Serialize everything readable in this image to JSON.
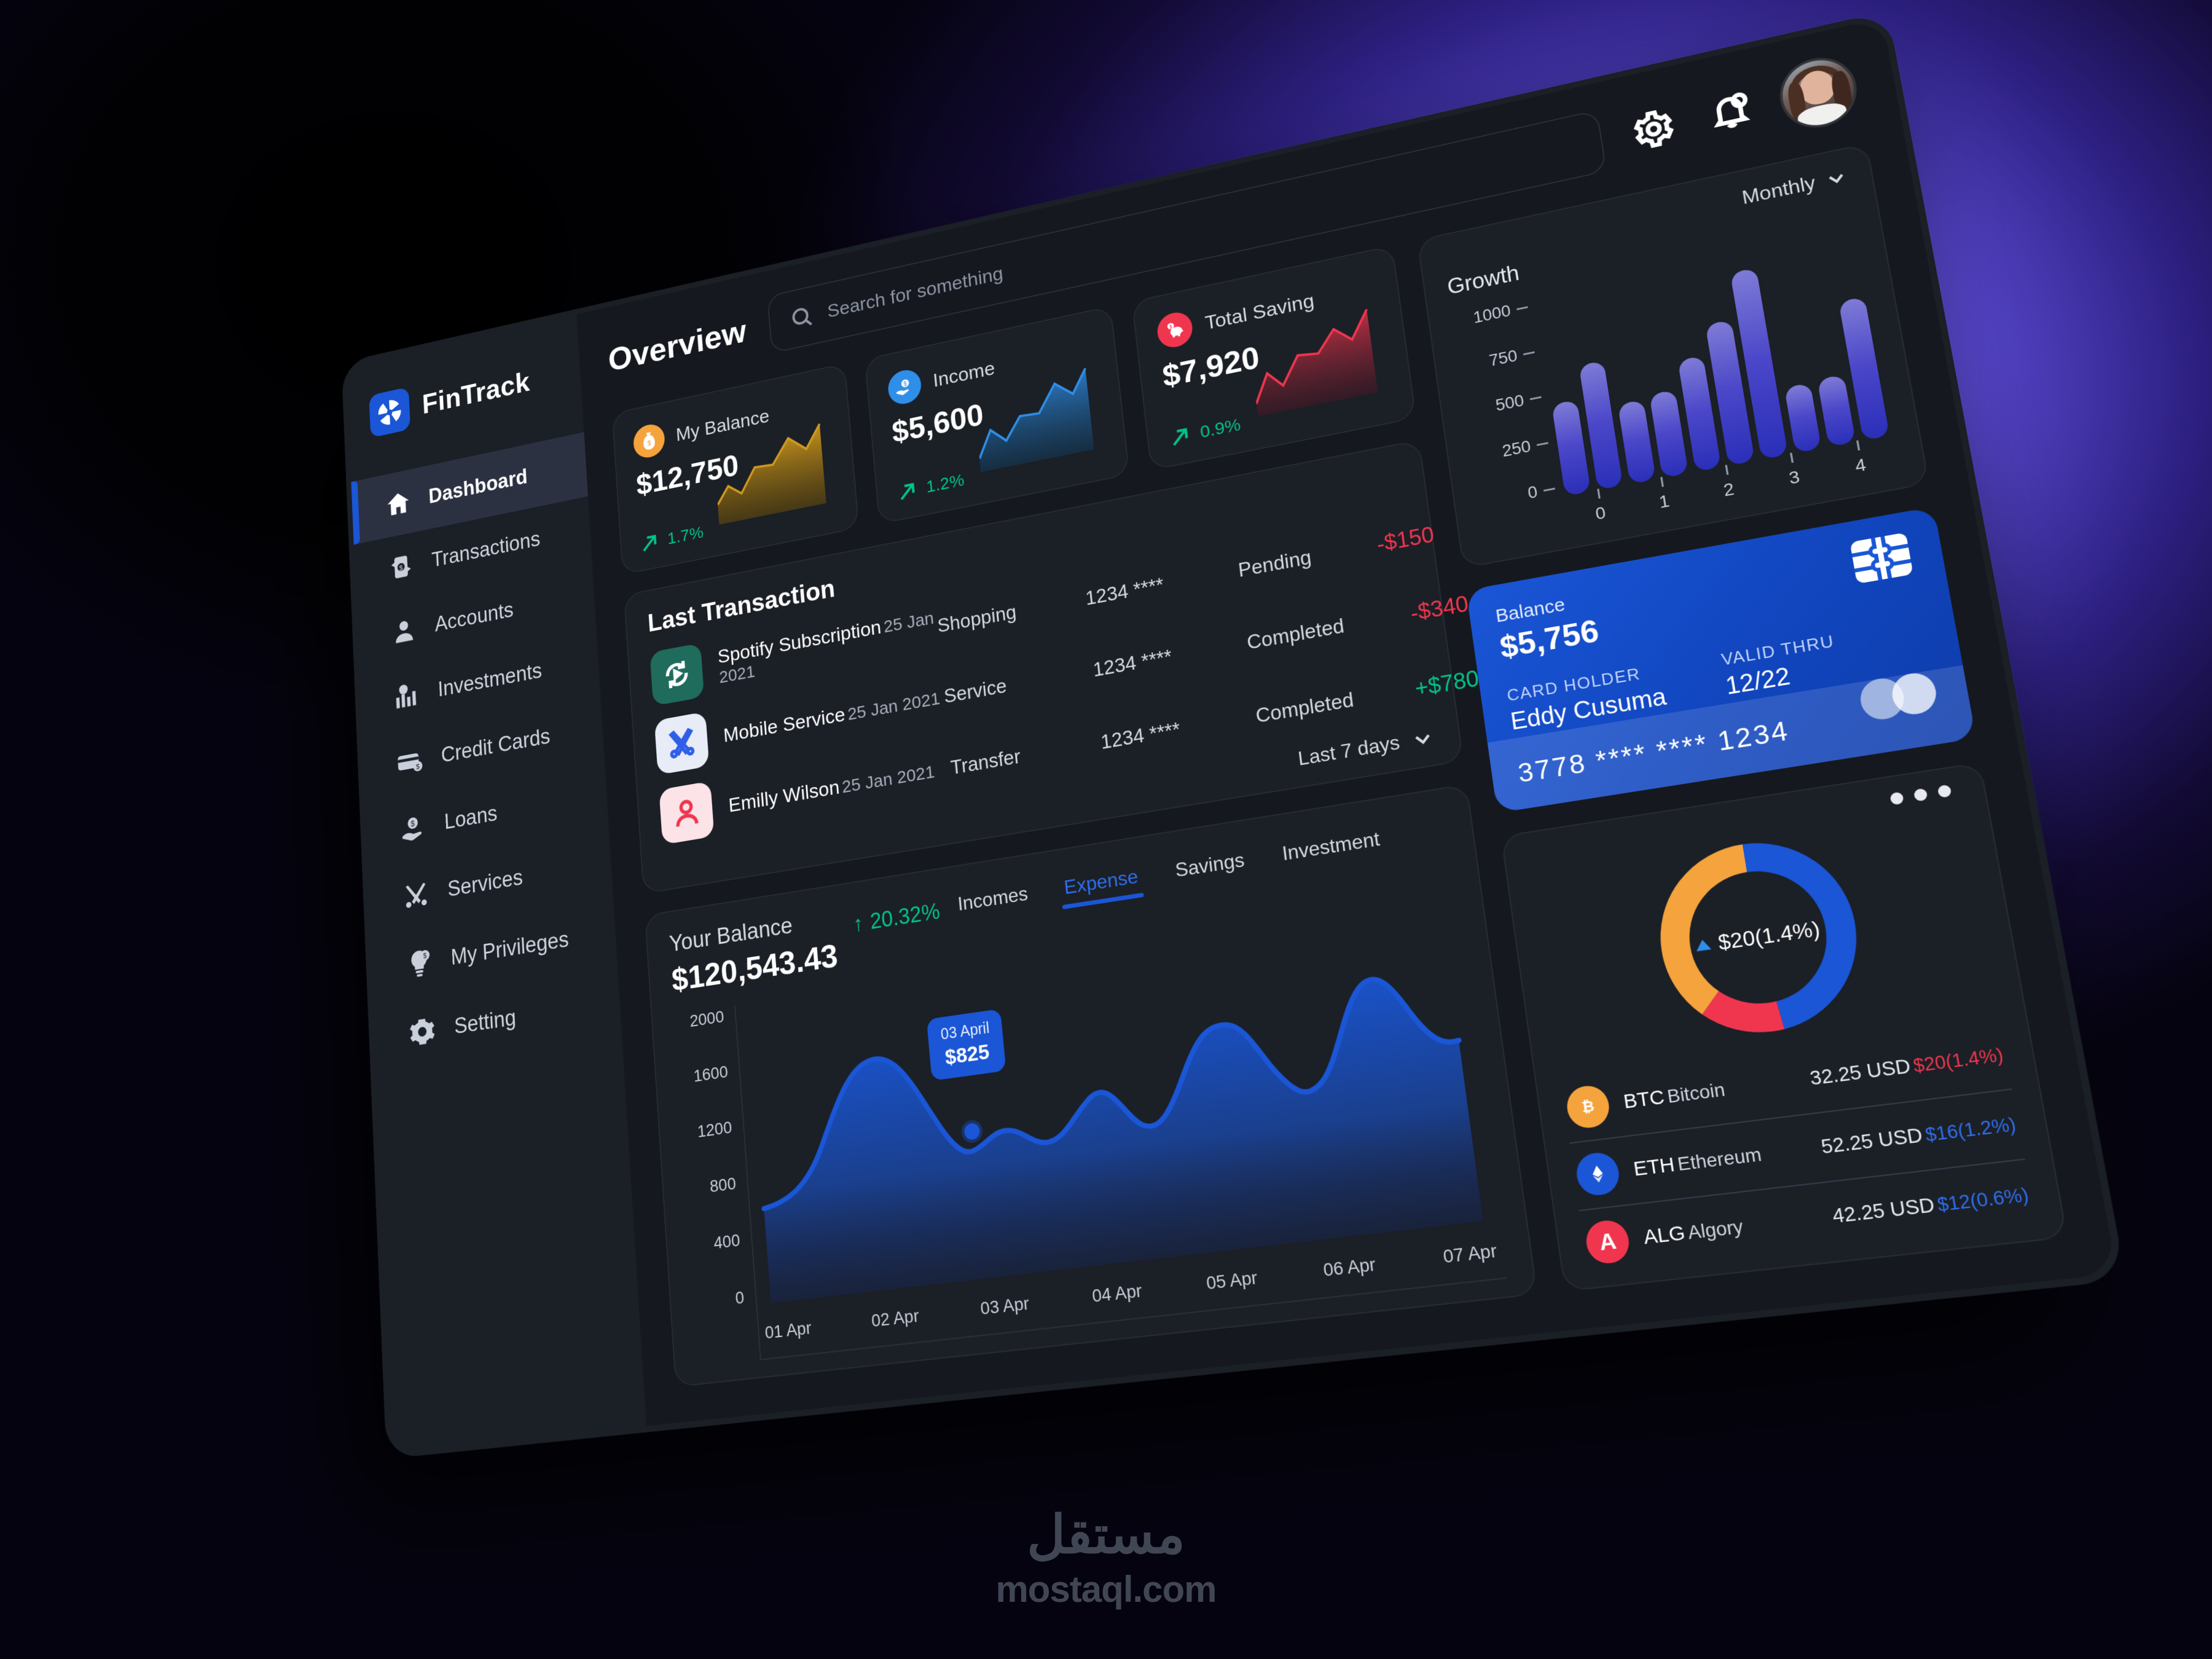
{
  "brand": {
    "name": "FinTrack",
    "logo_icon": "fintrack-logo-icon"
  },
  "header": {
    "page_title": "Overview",
    "search_placeholder": "Search for something",
    "gear_icon": "gear-icon",
    "bell_icon": "bell-icon",
    "avatar": "user-avatar"
  },
  "sidebar": {
    "items": [
      {
        "label": "Dashboard",
        "icon": "home-icon",
        "active": true
      },
      {
        "label": "Transactions",
        "icon": "transactions-icon",
        "active": false
      },
      {
        "label": "Accounts",
        "icon": "user-icon",
        "active": false
      },
      {
        "label": "Investments",
        "icon": "investments-icon",
        "active": false
      },
      {
        "label": "Credit Cards",
        "icon": "credit-card-icon",
        "active": false
      },
      {
        "label": "Loans",
        "icon": "loans-icon",
        "active": false
      },
      {
        "label": "Services",
        "icon": "services-icon",
        "active": false
      },
      {
        "label": "My Privileges",
        "icon": "privileges-icon",
        "active": false
      },
      {
        "label": "Setting",
        "icon": "gear-icon",
        "active": false
      }
    ]
  },
  "stats": [
    {
      "label": "My Balance",
      "value": "$12,750",
      "delta": "1.7%",
      "delta_dir": "up",
      "icon": "money-bag-icon",
      "badge_color": "#f5a33c",
      "line_color": "#d19a1f",
      "fill_color": "#8a6a12"
    },
    {
      "label": "Income",
      "value": "$5,600",
      "delta": "1.2%",
      "delta_dir": "up",
      "icon": "income-hand-icon",
      "badge_color": "#2f8fe8",
      "line_color": "#2f8fe8",
      "fill_color": "#1d4c74"
    },
    {
      "label": "Total Saving",
      "value": "$7,920",
      "delta": "0.9%",
      "delta_dir": "up",
      "icon": "piggy-bank-icon",
      "badge_color": "#f0364f",
      "line_color": "#f0364f",
      "fill_color": "#6d2334"
    }
  ],
  "last_transaction": {
    "title": "Last Transaction",
    "period_label": "Last 7 days",
    "rows": [
      {
        "name": "Spotify Subscription",
        "date": "25 Jan 2021",
        "category": "Shopping",
        "card": "1234 ****",
        "status": "Pending",
        "amount": "-$150",
        "sign": "neg",
        "icon": "spotify-refresh-icon",
        "icon_bg": "#1f6b5c",
        "icon_fg": "#ffffff"
      },
      {
        "name": "Mobile Service",
        "date": "25 Jan 2021",
        "category": "Service",
        "card": "1234 ****",
        "status": "Completed",
        "amount": "-$340",
        "sign": "neg",
        "icon": "tools-icon",
        "icon_bg": "#e8ecf7",
        "icon_fg": "#2f5fe8"
      },
      {
        "name": "Emilly Wilson",
        "date": "25 Jan 2021",
        "category": "Transfer",
        "card": "1234 ****",
        "status": "Completed",
        "amount": "+$780",
        "sign": "pos",
        "icon": "person-icon",
        "icon_bg": "#fbe3e8",
        "icon_fg": "#f0364f"
      }
    ]
  },
  "balance_card": {
    "title": "Your Balance",
    "amount": "$120,543.43",
    "growth": "20.32%",
    "growth_arrow": "↑",
    "tabs": [
      {
        "label": "Incomes",
        "active": false
      },
      {
        "label": "Expense",
        "active": true
      },
      {
        "label": "Savings",
        "active": false
      },
      {
        "label": "Investment",
        "active": false
      }
    ],
    "tooltip": {
      "date": "03 April",
      "value": "$825"
    }
  },
  "growth_card": {
    "title": "Growth",
    "period": "Monthly",
    "chevron_icon": "chevron-down-icon"
  },
  "credit_card": {
    "balance_label": "Balance",
    "balance": "$5,756",
    "holder_label": "CARD HOLDER",
    "holder": "Eddy Cusuma",
    "valid_label": "VALID THRU",
    "valid": "12/22",
    "number": "3778 **** **** 1234",
    "chip_icon": "card-chip-icon",
    "network_icon": "mastercard-icon"
  },
  "crypto_card": {
    "menu_icon": "more-dots-icon",
    "center_value": "$20(1.4%)",
    "rows": [
      {
        "symbol": "BTC",
        "name": "Bitcoin",
        "usd": "32.25 USD",
        "change": "$20(1.4%)",
        "change_color": "#f0364f",
        "icon": "bitcoin-icon",
        "icon_bg": "#f5a33c",
        "glyph": "Ƀ"
      },
      {
        "symbol": "ETH",
        "name": "Ethereum",
        "usd": "52.25 USD",
        "change": "$16(1.2%)",
        "change_color": "#2f6fed",
        "icon": "ethereum-icon",
        "icon_bg": "#1a56d6",
        "glyph": "◆"
      },
      {
        "symbol": "ALG",
        "name": "Algory",
        "usd": "42.25 USD",
        "change": "$12(0.6%)",
        "change_color": "#2f6fed",
        "icon": "algory-icon",
        "icon_bg": "#f0364f",
        "glyph": "A"
      }
    ]
  },
  "watermark": {
    "arabic": "مستقل",
    "latin": "mostaql.com"
  },
  "chart_data": [
    {
      "type": "area",
      "title": "Your Balance",
      "xlabel": "",
      "ylabel": "",
      "ylim": [
        0,
        2000
      ],
      "ytick_labels": [
        "2000",
        "1600",
        "1200",
        "800",
        "400",
        "0"
      ],
      "categories": [
        "01 Apr",
        "02 Apr",
        "03 Apr",
        "04 Apr",
        "05 Apr",
        "06 Apr",
        "07 Apr"
      ],
      "series": [
        {
          "name": "Expense",
          "x": [
            0,
            0.18,
            0.33,
            0.45,
            0.5,
            0.58,
            0.66,
            0.72,
            0.79,
            0.86,
            0.93,
            1.0
          ],
          "values": [
            620,
            1350,
            900,
            825,
            1280,
            1210,
            1450,
            1180,
            1620,
            1380,
            1820,
            1700
          ]
        }
      ],
      "annotation": {
        "date": "03 April",
        "value": 825,
        "label": "$825"
      },
      "grid": false,
      "legend": "none",
      "line_color": "#1a56d6"
    },
    {
      "type": "bar",
      "title": "Growth",
      "period": "Monthly",
      "ylim": [
        0,
        1100
      ],
      "ytick_labels": [
        "1000",
        "750",
        "500",
        "250",
        "0"
      ],
      "categories": [
        "0",
        "1",
        "2",
        "3",
        "4"
      ],
      "values": [
        500,
        680,
        430,
        450,
        600,
        760,
        1010,
        350,
        360,
        740
      ],
      "xlabel": "",
      "ylabel": "",
      "grid": false,
      "legend": "none",
      "bar_gradient": [
        "#7e7bd6",
        "#2a2fb8"
      ]
    },
    {
      "type": "pie",
      "title": "Crypto allocation",
      "labels": [
        "Bitcoin",
        "Ethereum",
        "Algory"
      ],
      "values": [
        38,
        48,
        14
      ],
      "colors": [
        "#f5a33c",
        "#1a56d6",
        "#f0364f"
      ],
      "center_label": "$20(1.4%)",
      "legend": "bottom"
    },
    {
      "type": "line",
      "title": "My Balance sparkline",
      "values": [
        30,
        48,
        28,
        62,
        60,
        86,
        70,
        100
      ],
      "line_color": "#d19a1f"
    },
    {
      "type": "line",
      "title": "Income sparkline",
      "values": [
        18,
        46,
        30,
        56,
        54,
        88,
        70,
        100
      ],
      "line_color": "#2f8fe8"
    },
    {
      "type": "line",
      "title": "Total Saving sparkline",
      "values": [
        20,
        46,
        30,
        62,
        58,
        80,
        66,
        100
      ],
      "line_color": "#f0364f"
    }
  ]
}
